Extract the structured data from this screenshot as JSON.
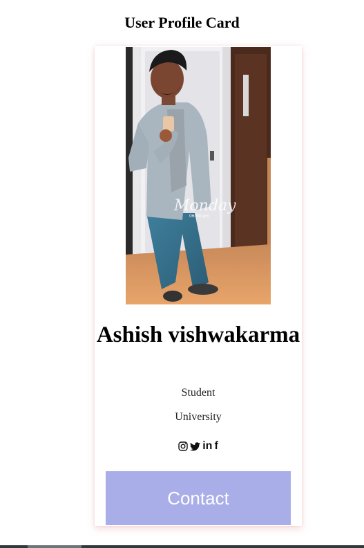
{
  "page": {
    "title": "User Profile Card"
  },
  "profile": {
    "name": "Ashish vishwakarma",
    "role": "Student",
    "organization": "University",
    "photo_overlay_text": "Monday",
    "photo_overlay_time": "06:50 pm"
  },
  "social_links": [
    {
      "icon": "instagram-icon"
    },
    {
      "icon": "twitter-icon"
    },
    {
      "icon": "linkedin-icon",
      "label": "in"
    },
    {
      "icon": "facebook-icon",
      "label": "f"
    }
  ],
  "contact_button": {
    "label": "Contact"
  },
  "colors": {
    "button_bg": "#aaaee8",
    "button_text": "#ffffff",
    "card_shadow": "#f0c8c8"
  }
}
